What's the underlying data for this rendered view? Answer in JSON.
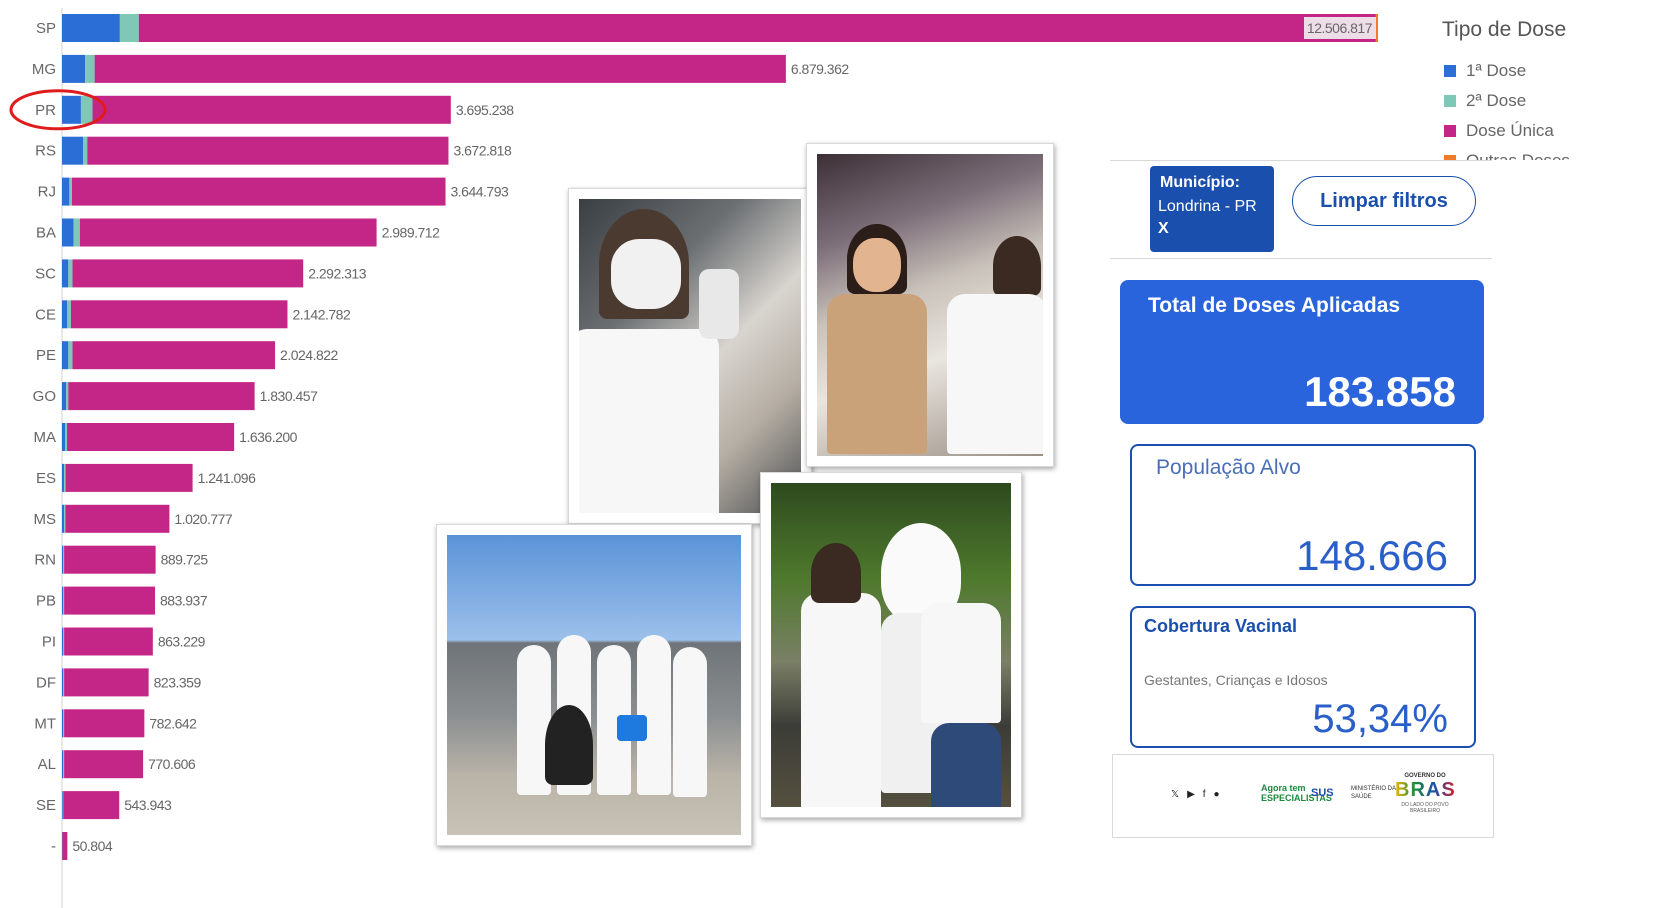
{
  "chart_data": {
    "type": "bar",
    "orientation": "horizontal",
    "stacked": true,
    "categories": [
      "SP",
      "MG",
      "PR",
      "RS",
      "RJ",
      "BA",
      "SC",
      "CE",
      "PE",
      "GO",
      "MA",
      "ES",
      "MS",
      "RN",
      "PB",
      "PI",
      "DF",
      "MT",
      "AL",
      "SE",
      "-"
    ],
    "total_labels": [
      "12.506.817",
      "6.879.362",
      "3.695.238",
      "3.672.818",
      "3.644.793",
      "2.989.712",
      "2.292.313",
      "2.142.782",
      "2.024.822",
      "1.830.457",
      "1.636.200",
      "1.241.096",
      "1.020.777",
      "889.725",
      "883.937",
      "863.229",
      "823.359",
      "782.642",
      "770.606",
      "543.943",
      "50.804"
    ],
    "series": [
      {
        "name": "1ª Dose",
        "color": "#2b6fd6",
        "values": [
          550000,
          220000,
          180000,
          200000,
          70000,
          110000,
          60000,
          50000,
          60000,
          40000,
          30000,
          20000,
          20000,
          12000,
          12000,
          12000,
          12000,
          12000,
          12000,
          8000,
          2000
        ]
      },
      {
        "name": "2ª Dose",
        "color": "#7fc8b8",
        "values": [
          180000,
          90000,
          110000,
          40000,
          25000,
          60000,
          40000,
          35000,
          40000,
          20000,
          18000,
          14000,
          12000,
          8000,
          8000,
          8000,
          8000,
          8000,
          8000,
          5000,
          1000
        ]
      },
      {
        "name": "Dose Única",
        "color": "#c42688",
        "values": [
          11756817,
          6569362,
          3405238,
          3432818,
          3549793,
          2819712,
          2192313,
          2057782,
          1924822,
          1770457,
          1588200,
          1207096,
          988777,
          869725,
          863937,
          843229,
          803359,
          762642,
          750606,
          530943,
          47804
        ]
      },
      {
        "name": "Outras Doses",
        "color": "#f07c2a",
        "values": [
          20000,
          0,
          0,
          0,
          0,
          0,
          0,
          0,
          0,
          0,
          0,
          0,
          0,
          0,
          0,
          0,
          0,
          0,
          0,
          0,
          0
        ]
      }
    ],
    "highlight_category": "PR",
    "legend_title": "Tipo de Dose",
    "legend_position": "right",
    "grid": false,
    "xlim": [
      0,
      12506817
    ]
  },
  "filter": {
    "label": "Município:",
    "value": "Londrina - PR",
    "clear_x": "X",
    "clear_button": "Limpar filtros"
  },
  "cards": {
    "total_title": "Total de Doses Aplicadas",
    "total_value": "183.858",
    "pop_title": "População Alvo",
    "pop_value": "148.666",
    "cov_title": "Cobertura Vacinal",
    "cov_subtitle": "Gestantes, Crianças e Idosos",
    "cov_value": "53,34%"
  },
  "footer": {
    "social_icons": [
      "x-icon",
      "youtube-icon",
      "facebook-icon",
      "flickr-icon"
    ],
    "esp_line1": "Agora tem",
    "esp_line2": "ESPECIALISTAS",
    "sus": "SUS",
    "ministry_line1": "MINISTÉRIO DA",
    "ministry_line2": "SAÚDE",
    "gov_line1": "GOVERNO DO",
    "gov_line2": "BRASIL",
    "gov_line3": "DO LADO DO POVO BRASILEIRO"
  },
  "colors": {
    "accent": "#1b4fae",
    "card_total_bg": "#2a64dc",
    "highlight_ring": "#e01b1b"
  }
}
